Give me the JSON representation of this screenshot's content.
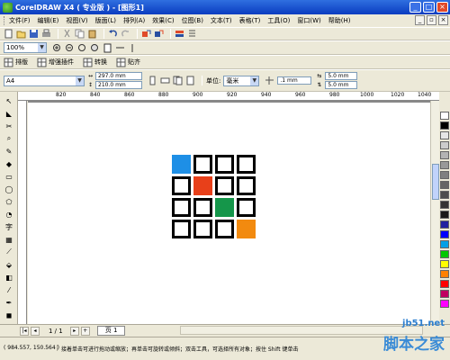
{
  "window": {
    "title": "CorelDRAW X4 ( 专业版 ) - [图形1]",
    "controls": [
      "_",
      "□",
      "×"
    ]
  },
  "menu": [
    "文件(F)",
    "编辑(E)",
    "视图(V)",
    "版面(L)",
    "排列(A)",
    "效果(C)",
    "位图(B)",
    "文本(T)",
    "表格(T)",
    "工具(O)",
    "窗口(W)",
    "帮助(H)"
  ],
  "toolbar": {
    "zoom": "100%"
  },
  "plugin_bar": {
    "items": [
      "排版",
      "增强插件",
      "转换",
      "贴齐"
    ]
  },
  "property_bar": {
    "paper": "A4",
    "width": "297.0 mm",
    "height": "210.0 mm",
    "unit_label": "单位:",
    "unit": "毫米",
    "nudge": ".1 mm",
    "dup_x": "5.0 mm",
    "dup_y": "5.0 mm"
  },
  "ruler": {
    "labels": [
      "820",
      "840",
      "860",
      "880",
      "900",
      "920",
      "940",
      "960",
      "980",
      "1000",
      "1020",
      "1040"
    ],
    "unit": "毫米"
  },
  "grid": {
    "filled": [
      {
        "row": 0,
        "col": 0,
        "color": "#1e8fe6"
      },
      {
        "row": 1,
        "col": 1,
        "color": "#e8401a"
      },
      {
        "row": 2,
        "col": 2,
        "color": "#15964a"
      },
      {
        "row": 3,
        "col": 3,
        "color": "#f28a0f"
      }
    ]
  },
  "palette": [
    "#ffffff",
    "#000000",
    "#e6e6e6",
    "#cccccc",
    "#b3b3b3",
    "#999999",
    "#808080",
    "#666666",
    "#4d4d4d",
    "#333333",
    "#1a1a1a",
    "#2020a0",
    "#0000ff",
    "#00a0e6",
    "#00c800",
    "#ffff00",
    "#ff8000",
    "#ff0000",
    "#c00060",
    "#ff00ff"
  ],
  "pages": {
    "indicator": "1 / 1",
    "tab": "页 1"
  },
  "status": {
    "coords": "( 984.557, 150.564 )",
    "hint": "接着单击可进行拖动或缩放；再单击可旋转或倾斜；双击工具，可选择所有对象；按住 Shift 键单击"
  },
  "watermark": {
    "site": "jb51.net",
    "name": "脚本之家"
  }
}
